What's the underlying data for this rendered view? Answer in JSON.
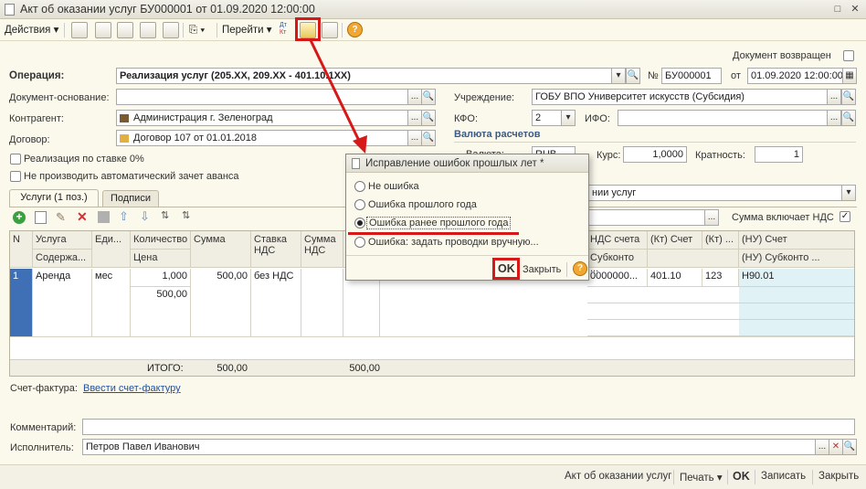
{
  "window": {
    "title": "Акт об оказании услуг БУ000001 от 01.09.2020 12:00:00"
  },
  "toolbar": {
    "actions": "Действия",
    "goto": "Перейти",
    "dt_kt_top": "Дт",
    "dt_kt_bottom": "Кт",
    "help": "?"
  },
  "header": {
    "returned_label": "Документ возвращен",
    "operation_label": "Операция:",
    "operation_value": "Реализация услуг (205.XX, 209.XX - 401.10.1XX)",
    "number_label": "№",
    "number_value": "БУ000001",
    "date_label": "от",
    "date_value": "01.09.2020 12:00:00",
    "basis_label": "Документ-основание:",
    "basis_value": "",
    "institution_label": "Учреждение:",
    "institution_value": "ГОБУ ВПО Университет искусств (Субсидия)",
    "counterparty_label": "Контрагент:",
    "counterparty_value": "Администрация г. Зеленоград",
    "kfo_label": "КФО:",
    "kfo_value": "2",
    "ifo_label": "ИФО:",
    "ifo_value": "",
    "contract_label": "Договор:",
    "contract_value": "Договор 107 от 01.01.2018",
    "currency_section": "Валюта расчетов",
    "currency_label": "Валюта:",
    "currency_value": "RUB",
    "rate_label": "Курс:",
    "rate_value": "1,0000",
    "multiplicity_label": "Кратность:",
    "multiplicity_value": "1",
    "rate0_label": "Реализация по ставке 0%",
    "no_advance_label": "Не производить автоматический зачет аванса",
    "op_type_value": "нии услуг",
    "vat_included_label": "Сумма включает НДС"
  },
  "tabs": [
    {
      "label": "Услуги (1 поз.)"
    },
    {
      "label": "Подписи"
    }
  ],
  "table": {
    "headers": {
      "n": "N",
      "service": "Услуга",
      "service_sub": "Содержа...",
      "unit": "Еди...",
      "qty": "Количество",
      "price": "Цена",
      "sum": "Сумма",
      "vat_rate": "Ставка НДС",
      "vat_sum": "Сумма НДС",
      "vat_account": "НДС счета",
      "subconto": "Субконто ...",
      "kt_account": "(Кт) Счет",
      "kt_short": "(Кт) ...",
      "nu_account": "(НУ) Счет",
      "nu_subconto": "(НУ) Субконто ..."
    },
    "row": {
      "n": "1",
      "service": "Аренда",
      "unit": "мес",
      "qty": "1,000",
      "price": "500,00",
      "sum": "500,00",
      "vat_rate": "без НДС",
      "vat_account": "0000000...",
      "kt_account": "401.10",
      "kt_short": "123",
      "nu_account": "Н90.01"
    },
    "totals": {
      "label": "ИТОГО:",
      "sum": "500,00",
      "vat": "500,00"
    }
  },
  "invoice": {
    "label": "Счет-фактура:",
    "link": "Ввести счет-фактуру"
  },
  "comment": {
    "label": "Комментарий:",
    "value": ""
  },
  "executor": {
    "label": "Исполнитель:",
    "value": "Петров Павел Иванович"
  },
  "footer": {
    "act": "Акт об оказании услуг",
    "print": "Печать",
    "ok": "OK",
    "save": "Записать",
    "close": "Закрыть"
  },
  "dialog": {
    "title": "Исправление ошибок прошлых лет *",
    "options": [
      "Не ошибка",
      "Ошибка прошлого года",
      "Ошибка ранее прошлого года",
      "Ошибка: задать проводки вручную..."
    ],
    "selected_index": 2,
    "ok": "OK",
    "close": "Закрыть",
    "help": "?"
  },
  "annotation_color": "#d61818"
}
